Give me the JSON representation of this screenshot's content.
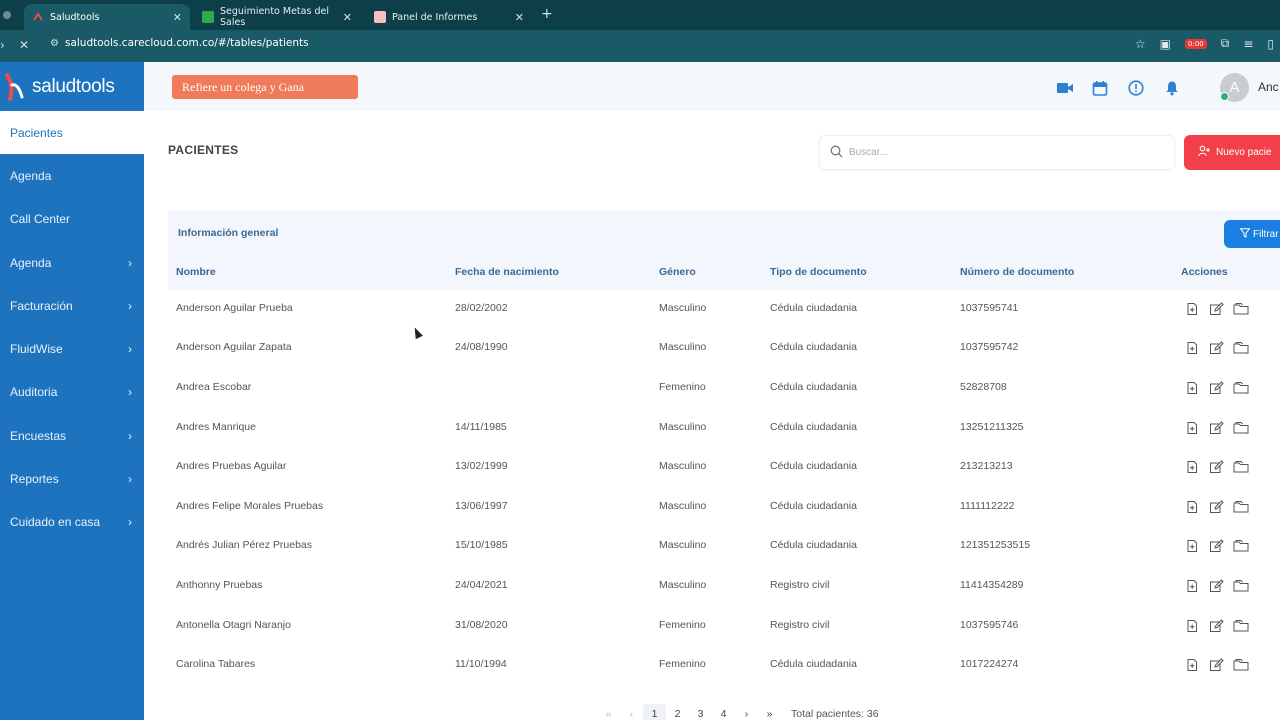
{
  "browser": {
    "tabs": [
      {
        "title": "Saludtools",
        "active": true
      },
      {
        "title": "Seguimiento Metas del Sales",
        "active": false
      },
      {
        "title": "Panel de Informes",
        "active": false
      }
    ],
    "url": "saludtools.carecloud.com.co/#/tables/patients",
    "rec_badge": "0:00"
  },
  "app": {
    "logo_text": "saludtools",
    "promo_label": "Refiere un colega y Gana",
    "user_name": "Anc",
    "avatar_letter": "A"
  },
  "sidebar": {
    "items": [
      {
        "label": "Pacientes",
        "active": true,
        "has_children": false
      },
      {
        "label": "Agenda",
        "active": false,
        "has_children": false
      },
      {
        "label": "Call Center",
        "active": false,
        "has_children": false
      },
      {
        "label": "Agenda",
        "active": false,
        "has_children": true
      },
      {
        "label": "Facturación",
        "active": false,
        "has_children": true
      },
      {
        "label": "FluidWise",
        "active": false,
        "has_children": true
      },
      {
        "label": "Auditoria",
        "active": false,
        "has_children": true
      },
      {
        "label": "Encuestas",
        "active": false,
        "has_children": true
      },
      {
        "label": "Reportes",
        "active": false,
        "has_children": true
      },
      {
        "label": "Cuidado en casa",
        "active": false,
        "has_children": true
      }
    ]
  },
  "main": {
    "title": "PACIENTES",
    "search_placeholder": "Buscar...",
    "new_button": "Nuevo pacie",
    "card_title": "Información general",
    "filter_button": "Filtrar",
    "columns": [
      "Nombre",
      "Fecha de nacimiento",
      "Género",
      "Tipo de documento",
      "Número de documento",
      "Acciones"
    ],
    "rows": [
      [
        "Anderson Aguilar Prueba",
        "28/02/2002",
        "Masculino",
        "Cédula ciudadania",
        "1037595741"
      ],
      [
        "Anderson Aguilar Zapata",
        "24/08/1990",
        "Masculino",
        "Cédula ciudadania",
        "1037595742"
      ],
      [
        "Andrea Escobar",
        "",
        "Femenino",
        "Cédula ciudadania",
        "52828708"
      ],
      [
        "Andres Manrique",
        "14/11/1985",
        "Masculino",
        "Cédula ciudadania",
        "13251211325"
      ],
      [
        "Andres Pruebas Aguilar",
        "13/02/1999",
        "Masculino",
        "Cédula ciudadania",
        "213213213"
      ],
      [
        "Andres Felipe Morales Pruebas",
        "13/06/1997",
        "Masculino",
        "Cédula ciudadania",
        "1111112222"
      ],
      [
        "Andrés Julian Pérez Pruebas",
        "15/10/1985",
        "Masculino",
        "Cédula ciudadania",
        "121351253515"
      ],
      [
        "Anthonny Pruebas",
        "24/04/2021",
        "Masculino",
        "Registro civil",
        "11414354289"
      ],
      [
        "Antonella Otagri Naranjo",
        "31/08/2020",
        "Femenino",
        "Registro civil",
        "1037595746"
      ],
      [
        "Carolina Tabares",
        "11/10/1994",
        "Femenino",
        "Cédula ciudadania",
        "1017224274"
      ]
    ],
    "pagination": {
      "first": "«",
      "prev": "‹",
      "pages": [
        "1",
        "2",
        "3",
        "4"
      ],
      "current": "1",
      "next": "›",
      "last": "»",
      "total_label": "Total pacientes: 36"
    }
  }
}
